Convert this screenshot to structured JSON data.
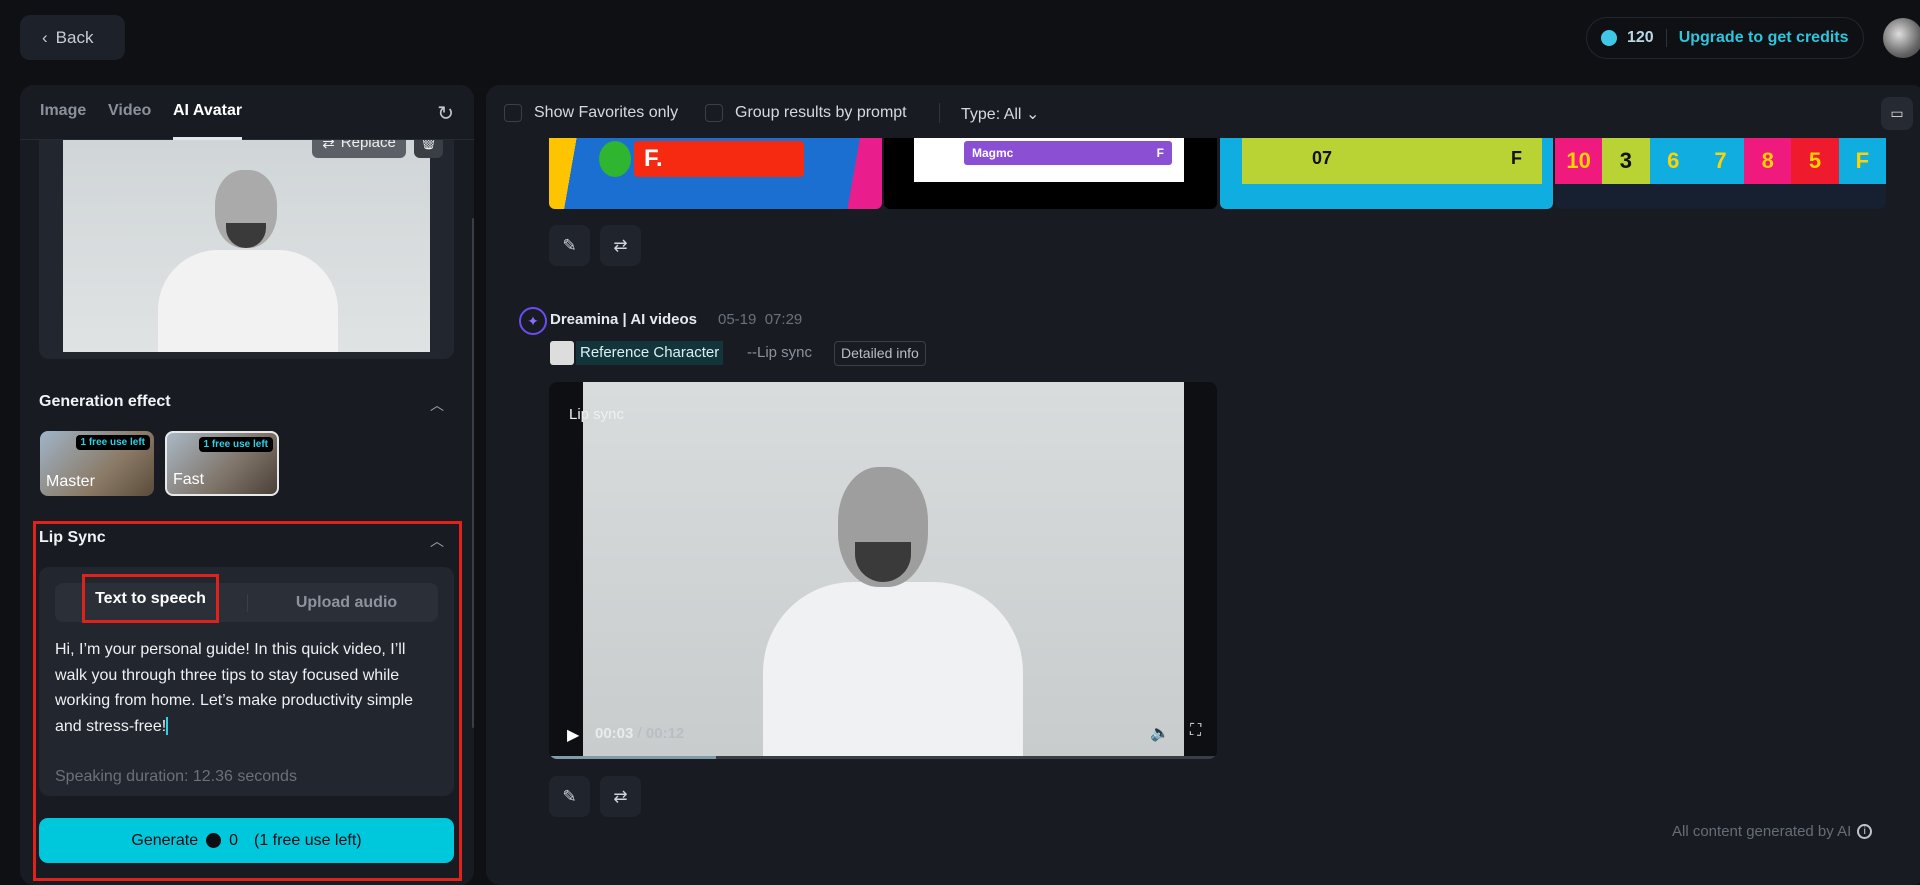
{
  "header": {
    "back_label": "Back",
    "credits": "120",
    "upgrade_label": "Upgrade to get credits"
  },
  "left": {
    "tabs": [
      "Image",
      "Video",
      "AI Avatar"
    ],
    "replace_label": "Replace",
    "generation_effect": {
      "title": "Generation effect",
      "options": [
        {
          "label": "Master",
          "badge": "1 free use left"
        },
        {
          "label": "Fast",
          "badge": "1 free use left"
        }
      ]
    },
    "lip_sync": {
      "title": "Lip Sync",
      "modes": [
        "Text to speech",
        "Upload audio"
      ],
      "text": "Hi, I’m your personal guide! In this quick video, I’ll walk you through three tips to stay focused while working from home. Let’s make productivity simple and stress-free!",
      "duration": "Speaking duration: 12.36 seconds"
    },
    "generate": {
      "label": "Generate",
      "cost": "0",
      "note": "(1 free use left)"
    }
  },
  "toolbar": {
    "favorites_label": "Show Favorites only",
    "group_label": "Group results by prompt",
    "type_label": "Type: All"
  },
  "strip": {
    "a": "F.",
    "b": "Magmc",
    "b2": "F",
    "c": "07",
    "c2": "F",
    "d": [
      "10",
      "3",
      "6",
      "7",
      "8",
      "5",
      "F"
    ]
  },
  "message": {
    "author": "Dreamina | AI videos",
    "date": "05-19",
    "time": "07:29",
    "ref_label": "Reference Character",
    "mode": "--Lip sync",
    "details_label": "Detailed info",
    "video": {
      "label": "Lip sync",
      "current": "00:03",
      "sep": "/",
      "total": "00:12",
      "progress": 0.25
    }
  },
  "footer": {
    "disclaimer": "All content generated by AI"
  },
  "colors": {
    "accent": "#00c8dc",
    "highlight": "#e0221d"
  }
}
